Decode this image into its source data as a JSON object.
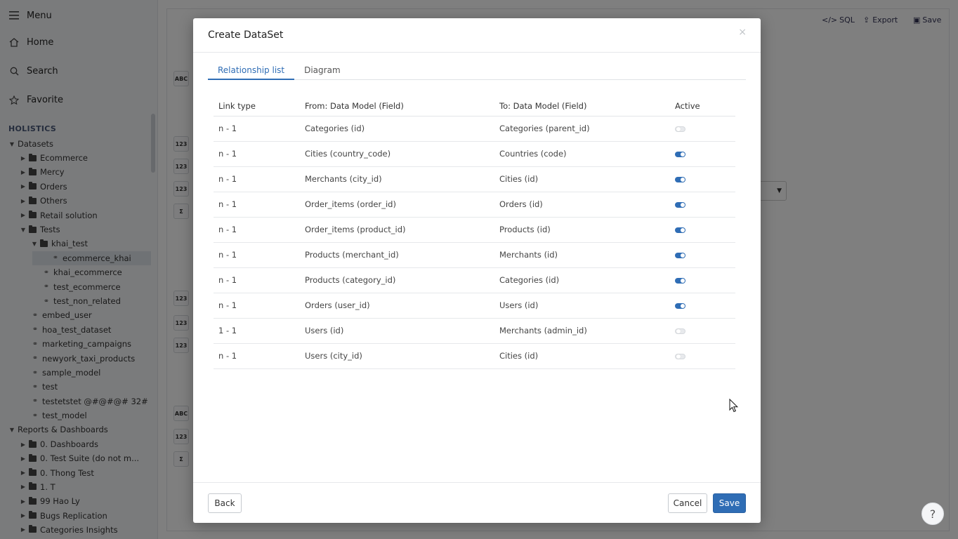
{
  "sidebar": {
    "menu": "Menu",
    "home": "Home",
    "search": "Search",
    "favorite": "Favorite",
    "section": "HOLISTICS",
    "datasets_root": "Datasets",
    "tree": [
      {
        "label": "Ecommerce",
        "kind": "folder",
        "level": 1,
        "expanded": false
      },
      {
        "label": "Mercy",
        "kind": "folder",
        "level": 1,
        "expanded": false
      },
      {
        "label": "Orders",
        "kind": "folder",
        "level": 1,
        "expanded": false
      },
      {
        "label": "Others",
        "kind": "folder",
        "level": 1,
        "expanded": false
      },
      {
        "label": "Retail solution",
        "kind": "folder",
        "level": 1,
        "expanded": false
      },
      {
        "label": "Tests",
        "kind": "folder",
        "level": 1,
        "expanded": true
      },
      {
        "label": "khai_test",
        "kind": "folder",
        "level": 2,
        "expanded": true
      },
      {
        "label": "ecommerce_khai",
        "kind": "dataset",
        "level": 3,
        "selected": true
      },
      {
        "label": "khai_ecommerce",
        "kind": "dataset",
        "level": 3
      },
      {
        "label": "test_ecommerce",
        "kind": "dataset",
        "level": 3
      },
      {
        "label": "test_non_related",
        "kind": "dataset",
        "level": 3
      },
      {
        "label": "embed_user",
        "kind": "dataset",
        "level": 2
      },
      {
        "label": "hoa_test_dataset",
        "kind": "dataset",
        "level": 2
      },
      {
        "label": "marketing_campaigns",
        "kind": "dataset",
        "level": 2
      },
      {
        "label": "newyork_taxi_products",
        "kind": "dataset",
        "level": 2
      },
      {
        "label": "sample_model",
        "kind": "dataset",
        "level": 2
      },
      {
        "label": "test",
        "kind": "dataset",
        "level": 2
      },
      {
        "label": "testetstet @#@#@# 32#",
        "kind": "dataset",
        "level": 2
      },
      {
        "label": "test_model",
        "kind": "dataset",
        "level": 2
      }
    ],
    "reports_root": "Reports & Dashboards",
    "reports": [
      {
        "label": "0. Dashboards"
      },
      {
        "label": "0. Test Suite (do not m..."
      },
      {
        "label": "0. Thong Test"
      },
      {
        "label": "1. T"
      },
      {
        "label": "99 Hao Ly"
      },
      {
        "label": "Bugs Replication"
      },
      {
        "label": "Categories Insights"
      }
    ]
  },
  "toolbar": {
    "sql": "SQL",
    "export": "Export",
    "save": "Save"
  },
  "side_badges": [
    "ABC",
    "123",
    "123",
    "123",
    "Σ",
    "123",
    "123",
    "123",
    "ABC",
    "123",
    "Σ"
  ],
  "modal": {
    "title": "Create DataSet",
    "close": "×",
    "tabs": [
      {
        "label": "Relationship list",
        "active": true
      },
      {
        "label": "Diagram",
        "active": false
      }
    ],
    "columns": {
      "link_type": "Link type",
      "from": "From: Data Model (Field)",
      "to": "To: Data Model (Field)",
      "active": "Active"
    },
    "rows": [
      {
        "link_type": "n - 1",
        "from": "Categories (id)",
        "to": "Categories (parent_id)",
        "active": false
      },
      {
        "link_type": "n - 1",
        "from": "Cities (country_code)",
        "to": "Countries (code)",
        "active": true
      },
      {
        "link_type": "n - 1",
        "from": "Merchants (city_id)",
        "to": "Cities (id)",
        "active": true
      },
      {
        "link_type": "n - 1",
        "from": "Order_items (order_id)",
        "to": "Orders (id)",
        "active": true
      },
      {
        "link_type": "n - 1",
        "from": "Order_items (product_id)",
        "to": "Products (id)",
        "active": true
      },
      {
        "link_type": "n - 1",
        "from": "Products (merchant_id)",
        "to": "Merchants (id)",
        "active": true
      },
      {
        "link_type": "n - 1",
        "from": "Products (category_id)",
        "to": "Categories (id)",
        "active": true
      },
      {
        "link_type": "n - 1",
        "from": "Orders (user_id)",
        "to": "Users (id)",
        "active": true
      },
      {
        "link_type": "1 - 1",
        "from": "Users (id)",
        "to": "Merchants (admin_id)",
        "active": false
      },
      {
        "link_type": "n - 1",
        "from": "Users (city_id)",
        "to": "Cities (id)",
        "active": false
      }
    ],
    "footer": {
      "back": "Back",
      "cancel": "Cancel",
      "save": "Save"
    }
  },
  "help": "?",
  "colors": {
    "primary": "#2f6db5",
    "overlay": "rgba(0,0,0,0.5)"
  }
}
